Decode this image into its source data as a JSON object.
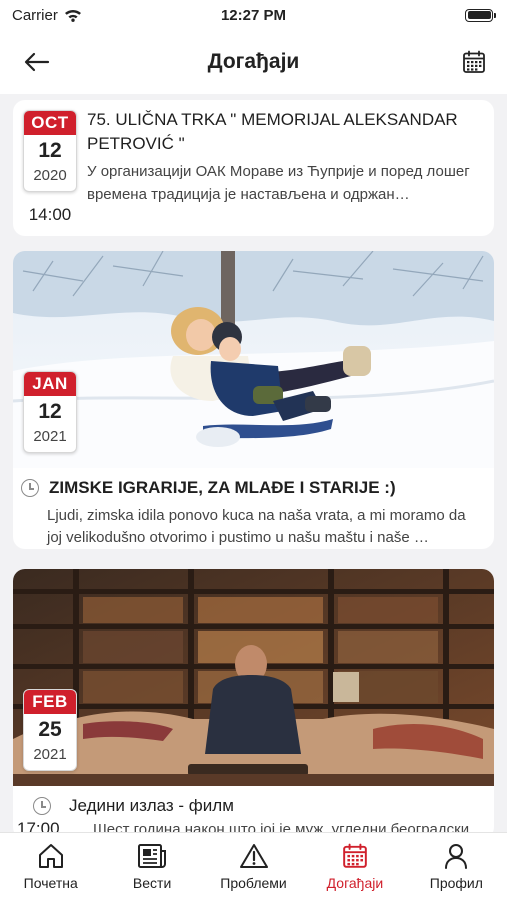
{
  "status_bar": {
    "carrier": "Carrier",
    "time": "12:27 PM"
  },
  "header": {
    "title": "Догађаји"
  },
  "events": [
    {
      "month": "OCT",
      "day": "12",
      "year": "2020",
      "time": "14:00",
      "title": "75. ULIČNA TRKA \" MEMORIJAL ALEKSANDAR PETROVIĆ \"",
      "description": "У организацији ОАК Мораве из Ћуприје и поред лошег времена традиција је настављена и одржан…"
    },
    {
      "month": "JAN",
      "day": "12",
      "year": "2021",
      "title": "ZIMSKE IGRARIJE, ZA MLAĐE I STARIJE :)",
      "description": "Ljudi, zimska idila ponovo kuca na naša vrata, a mi moramo da joj velikodušno otvorimo i pustimo u našu maštu i naše …"
    },
    {
      "month": "FEB",
      "day": "25",
      "year": "2021",
      "time": "17:00",
      "title": "Једини излаз - филм",
      "description": "Шест година након што јој је муж, угледни београдски"
    }
  ],
  "tabs": [
    {
      "label": "Почетна",
      "icon": "home-icon"
    },
    {
      "label": "Вести",
      "icon": "newspaper-icon"
    },
    {
      "label": "Проблеми",
      "icon": "warning-icon"
    },
    {
      "label": "Догађаји",
      "icon": "calendar-icon",
      "active": true
    },
    {
      "label": "Профил",
      "icon": "user-icon"
    }
  ],
  "colors": {
    "accent": "#d0202c",
    "background": "#f2f2f4",
    "text": "#222222"
  }
}
